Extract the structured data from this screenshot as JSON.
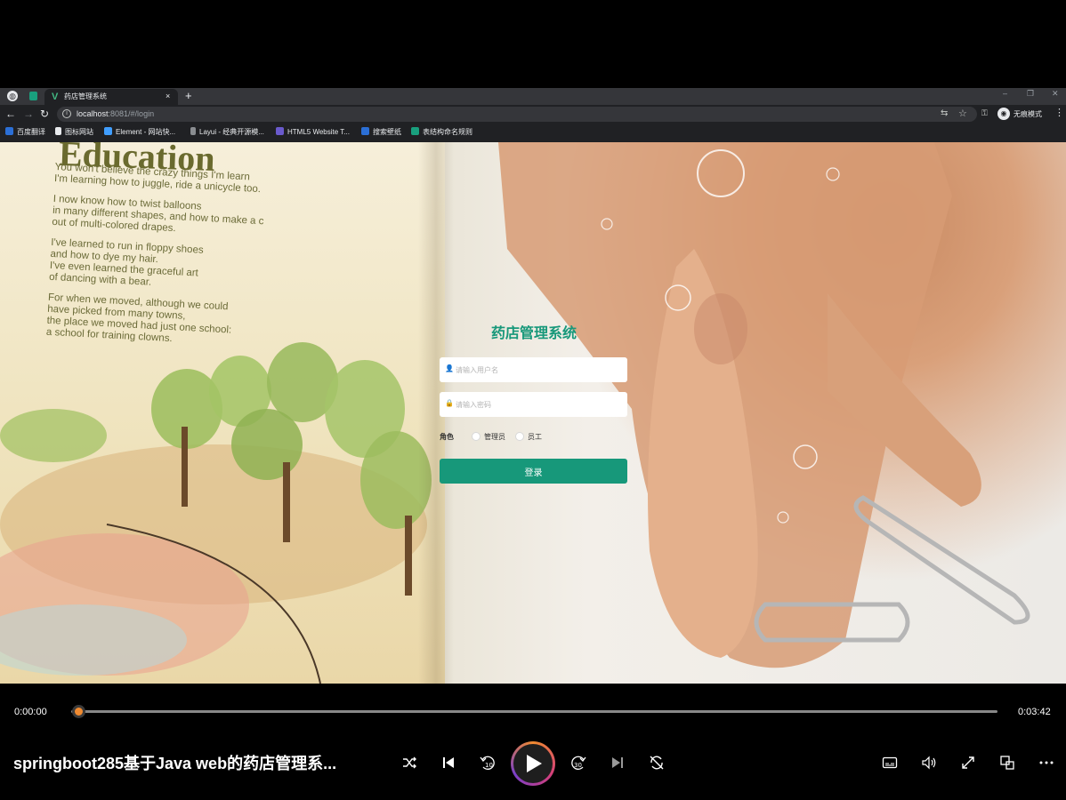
{
  "browser": {
    "tab_title": "药店管理系统",
    "close_glyph": "×",
    "newtab_glyph": "+",
    "url_host": "localhost",
    "url_rest": ":8081/#/login",
    "incognito_label": "无痕模式",
    "bookmarks": [
      {
        "label": "百度翻译",
        "color": "#2b6fd6"
      },
      {
        "label": "图标网站",
        "color": "#e8eaed"
      },
      {
        "label": "Element - 网站快...",
        "color": "#409eff"
      },
      {
        "label": "Layui - 经典开源模...",
        "color": "#e8eaed"
      },
      {
        "label": "HTML5 Website T...",
        "color": "#6a5acd"
      },
      {
        "label": "搜索壁纸",
        "color": "#2b6fd6"
      },
      {
        "label": "表结构命名规则",
        "color": "#19a07e"
      }
    ]
  },
  "background_text": {
    "heading": "Education",
    "paragraphs": [
      "You won't believe the crazy things I'm learn\nI'm learning how to juggle, ride a unicycle too.",
      "I now know how to twist balloons\nin many different shapes, and how to make a c\nout of multi-colored drapes.",
      "I've learned to run in floppy shoes\nand how to dye my hair.\nI've even learned the graceful art\nof dancing with a bear.",
      "For when we moved, although we could\nhave picked from many towns,\nthe place we moved had just one school:\na school for training clowns."
    ]
  },
  "login": {
    "title": "药店管理系统",
    "username_placeholder": "请输入用户名",
    "password_placeholder": "请输入密码",
    "role_label": "角色",
    "role_options": [
      "管理员",
      "员工"
    ],
    "submit_label": "登录",
    "accent_color": "#17987a"
  },
  "player": {
    "current_time": "0:00:00",
    "total_time": "0:03:42",
    "progress": 0.0,
    "video_title": "springboot285基于Java web的药店管理系...",
    "icons": [
      "shuffle-icon",
      "previous-icon",
      "rewind-10-icon",
      "play-icon",
      "forward-30-icon",
      "next-icon",
      "repeat-icon",
      "subtitles-icon",
      "volume-icon",
      "fullscreen-icon",
      "miniplayer-icon",
      "more-icon"
    ]
  }
}
